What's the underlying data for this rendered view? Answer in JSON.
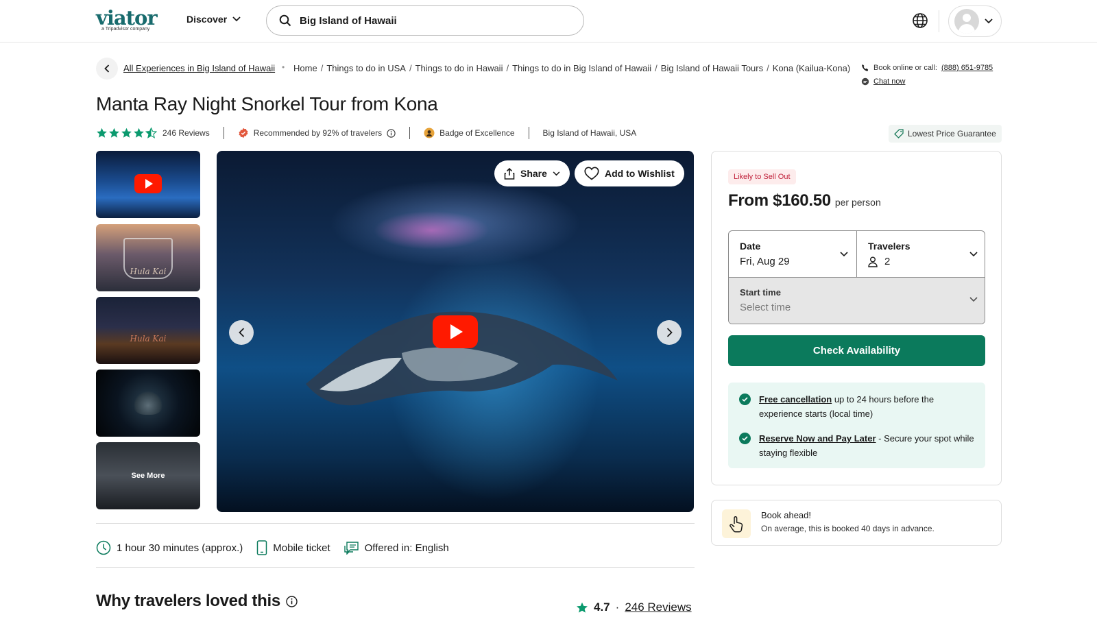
{
  "header": {
    "logo_text": "viator",
    "logo_sub": "a Tripadvisor company",
    "discover_label": "Discover",
    "search_value": "Big Island of Hawaii",
    "brand_color": "#186b6d"
  },
  "breadcrumb": {
    "back_link": "All Experiences in Big Island of Hawaii",
    "crumbs": [
      "Home",
      "Things to do in USA",
      "Things to do in Hawaii",
      "Things to do in Big Island of Hawaii",
      "Big Island of Hawaii Tours",
      "Kona (Kailua-Kona)"
    ],
    "separator": "/"
  },
  "contact": {
    "book_text": "Book online or call:",
    "phone": "(888) 651-9785",
    "chat": "Chat now"
  },
  "product": {
    "title": "Manta Ray Night Snorkel Tour from Kona",
    "rating_stars": 4.5,
    "reviews_label": "246 Reviews",
    "recommended": "Recommended by 92% of travelers",
    "badge": "Badge of Excellence",
    "location": "Big Island of Hawaii, USA",
    "lowest_price": "Lowest Price Guarantee"
  },
  "gallery": {
    "thumb2_caption": "Hula Kai",
    "thumb3_caption": "Hula Kai",
    "see_more": "See More",
    "share_label": "Share",
    "wishlist_label": "Add to Wishlist"
  },
  "details": {
    "duration": "1 hour 30 minutes (approx.)",
    "ticket": "Mobile ticket",
    "language": "Offered in: English"
  },
  "why": {
    "heading": "Why travelers loved this",
    "score": "4.7",
    "dot": "·",
    "reviews_link": "246 Reviews"
  },
  "booking": {
    "badge": "Likely to Sell Out",
    "price": "From $160.50",
    "per": "per person",
    "date_label": "Date",
    "date_value": "Fri, Aug 29",
    "travelers_label": "Travelers",
    "travelers_value": "2",
    "start_label": "Start time",
    "start_placeholder": "Select time",
    "check_button": "Check Availability",
    "perk1_link": "Free cancellation",
    "perk1_text": " up to 24 hours before the experience starts (local time)",
    "perk2_link": "Reserve Now and Pay Later",
    "perk2_text": " - Secure your spot while staying flexible",
    "accent_color": "#0b7a5c"
  },
  "book_ahead": {
    "title": "Book ahead!",
    "text": "On average, this is booked 40 days in advance."
  }
}
